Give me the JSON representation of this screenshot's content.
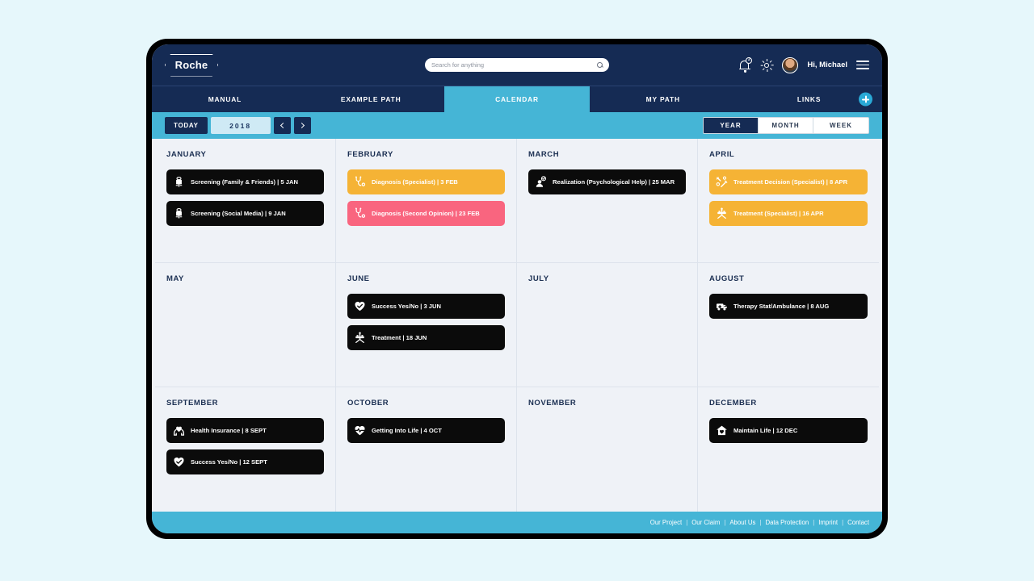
{
  "brand": {
    "name": "Roche"
  },
  "search": {
    "placeholder": "Search for anything",
    "value": "",
    "icon": "search-icon"
  },
  "topbar": {
    "notifications": {
      "icon": "bell-icon",
      "count": "2"
    },
    "theme_toggle": {
      "icon": "sun-icon"
    },
    "avatar": {
      "icon": "avatar"
    },
    "greeting": "Hi, Michael",
    "menu": {
      "icon": "hamburger-menu-icon"
    }
  },
  "nav": {
    "tabs": [
      {
        "label": "MANUAL",
        "active": false
      },
      {
        "label": "EXAMPLE PATH",
        "active": false
      },
      {
        "label": "CALENDAR",
        "active": true
      },
      {
        "label": "MY PATH",
        "active": false
      },
      {
        "label": "LINKS",
        "active": false
      }
    ],
    "add_button": {
      "icon": "plus-icon",
      "label": "+"
    }
  },
  "toolbar": {
    "today_label": "TODAY",
    "year": "2018",
    "prev": {
      "icon": "chevron-left-icon"
    },
    "next": {
      "icon": "chevron-right-icon"
    },
    "views": [
      {
        "label": "YEAR",
        "active": true
      },
      {
        "label": "MONTH",
        "active": false
      },
      {
        "label": "WEEK",
        "active": false
      }
    ]
  },
  "calendar": {
    "months": [
      {
        "name": "JANUARY",
        "events": [
          {
            "label": "Screening (Family & Friends) | 5 JAN",
            "color": "dark",
            "icon": "screening-icon"
          },
          {
            "label": "Screening (Social Media) | 9 JAN",
            "color": "dark",
            "icon": "screening-icon"
          }
        ]
      },
      {
        "name": "FEBRUARY",
        "events": [
          {
            "label": "Diagnosis (Specialist) | 3 FEB",
            "color": "amber",
            "icon": "stethoscope-icon"
          },
          {
            "label": "Diagnosis (Second Opinion) | 23 FEB",
            "color": "pink",
            "icon": "stethoscope-icon"
          }
        ]
      },
      {
        "name": "MARCH",
        "events": [
          {
            "label": "Realization (Psychological Help) | 25 MAR",
            "color": "dark",
            "icon": "person-thought-icon"
          }
        ]
      },
      {
        "name": "APRIL",
        "events": [
          {
            "label": "Treatment Decision (Specialist) | 8 APR",
            "color": "amber",
            "icon": "pills-syringe-icon"
          },
          {
            "label": "Treatment (Specialist) | 16 APR",
            "color": "amber",
            "icon": "medical-chair-icon"
          }
        ]
      },
      {
        "name": "MAY",
        "events": []
      },
      {
        "name": "JUNE",
        "events": [
          {
            "label": "Success Yes/No | 3 JUN",
            "color": "dark",
            "icon": "heart-check-icon"
          },
          {
            "label": "Treatment | 18 JUN",
            "color": "dark",
            "icon": "medical-chair-icon"
          }
        ]
      },
      {
        "name": "JULY",
        "events": []
      },
      {
        "name": "AUGUST",
        "events": [
          {
            "label": "Therapy Stat/Ambulance | 8 AUG",
            "color": "dark",
            "icon": "ambulance-icon"
          }
        ]
      },
      {
        "name": "SEPTEMBER",
        "events": [
          {
            "label": "Health Insurance | 8 SEPT",
            "color": "dark",
            "icon": "heart-hands-icon"
          },
          {
            "label": "Success Yes/No | 12 SEPT",
            "color": "dark",
            "icon": "heart-check-icon"
          }
        ]
      },
      {
        "name": "OCTOBER",
        "events": [
          {
            "label": "Getting Into Life | 4 OCT",
            "color": "dark",
            "icon": "heartbeat-icon"
          }
        ]
      },
      {
        "name": "NOVEMBER",
        "events": []
      },
      {
        "name": "DECEMBER",
        "events": [
          {
            "label": "Maintain Life | 12 DEC",
            "color": "dark",
            "icon": "home-heart-icon"
          }
        ]
      }
    ]
  },
  "footer": {
    "separator": "|",
    "links": [
      "Our Project",
      "Our Claim",
      "About Us",
      "Data Protection",
      "Imprint",
      "Contact"
    ]
  },
  "colors": {
    "navy": "#152b54",
    "cyan": "#45b5d6",
    "amber": "#f5b335",
    "pink": "#f9657f",
    "dark": "#0b0b0b",
    "page_bg": "#e6f7fb",
    "calendar_bg": "#eff2f7"
  }
}
